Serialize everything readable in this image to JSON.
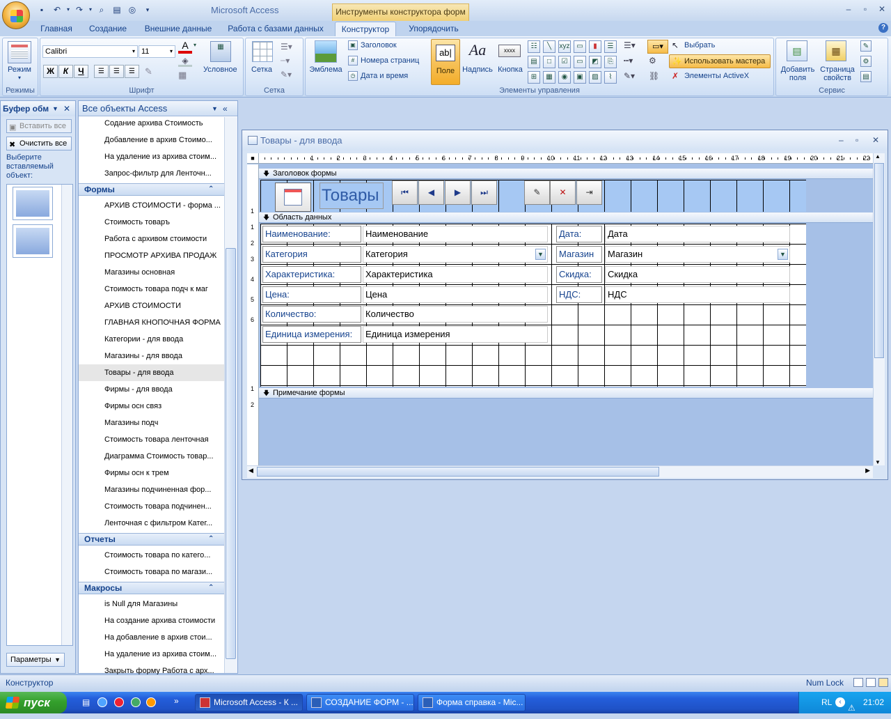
{
  "app": {
    "title": "Microsoft Access",
    "context_tool": "Инструменты конструктора форм"
  },
  "tabs": [
    "Главная",
    "Создание",
    "Внешние данные",
    "Работа с базами данных",
    "Конструктор",
    "Упорядочить"
  ],
  "active_tab": "Конструктор",
  "ribbon": {
    "mode_group": {
      "button": "Режим",
      "label": "Режимы"
    },
    "font_group": {
      "font_name": "Calibri",
      "font_size": "11",
      "conditional": "Условное",
      "label": "Шрифт",
      "bold": "Ж",
      "italic": "К",
      "underline": "Ч"
    },
    "grid_group": {
      "button": "Сетка",
      "label": "Сетка"
    },
    "controls_group": {
      "emblem": "Эмблема",
      "header_title": "Заголовок",
      "page_numbers": "Номера страниц",
      "date_time": "Дата и время",
      "field": "Поле",
      "label_ctl": "Надпись",
      "button_ctl": "Кнопка",
      "select": "Выбрать",
      "use_wizards": "Использовать мастера",
      "activex": "Элементы ActiveX",
      "label": "Элементы управления"
    },
    "tools_group": {
      "add_fields": "Добавить поля",
      "property_sheet": "Страница свойств",
      "label": "Сервис"
    }
  },
  "clipboard": {
    "title": "Буфер обм",
    "paste_all": "Вставить все",
    "clear_all": "Очистить все",
    "hint": "Выберите вставляемый объект:",
    "params": "Параметры"
  },
  "nav": {
    "header": "Все объекты Access",
    "queries": [
      "Содание архива Стоимость",
      "Добавление в архив Стоимо...",
      "На удаление из архива стоим...",
      "Запрос-фильтр для Ленточн..."
    ],
    "forms_header": "Формы",
    "forms": [
      "АРХИВ СТОИМОСТИ - форма ...",
      "Стоимость товаръ",
      "Работа с архивом стоимости",
      "ПРОСМОТР АРХИВА ПРОДАЖ",
      "Магазины основная",
      "Стоимость товара подч к маг",
      "АРХИВ СТОИМОСТИ",
      "ГЛАВНАЯ КНОПОЧНАЯ ФОРМА",
      "Категории - для ввода",
      "Магазины - для ввода",
      "Товары - для ввода",
      "Фирмы - для ввода",
      "Фирмы осн связ",
      "Магазины подч",
      "Стоимость товара ленточная",
      "Диаграмма Стоимость товар...",
      "Фирмы осн к трем",
      "Магазины подчиненная фор...",
      "Стоимость товара подчинен...",
      "Ленточная с фильтром Катег..."
    ],
    "selected_form": "Товары - для ввода",
    "reports_header": "Отчеты",
    "reports": [
      "Стоимость товара по катего...",
      "Стоимость товара по магази..."
    ],
    "macros_header": "Макросы",
    "macros": [
      "is Null для Магазины",
      "На создание архива стоимости",
      "На добавление в архив стои...",
      "На удаление из архива стоим...",
      "Закрыть форму Работа с арх..."
    ]
  },
  "form_window": {
    "title": "Товары - для ввода",
    "ruler_marks": [
      "1",
      "2",
      "3",
      "4",
      "5",
      "6",
      "7",
      "8",
      "9",
      "10",
      "11",
      "12",
      "13",
      "14",
      "15",
      "16",
      "17",
      "18",
      "19",
      "20",
      "21",
      "22",
      "23"
    ],
    "left_ruler_marks": [
      "1",
      "1",
      "2",
      "3",
      "4",
      "5",
      "6",
      "1",
      "2"
    ],
    "header_section": "Заголовок формы",
    "header_title": "Товары",
    "detail_section": "Область данных",
    "footer_section": "Примечание формы",
    "fields_left": [
      {
        "label": "Наименование:",
        "field": "Наименование"
      },
      {
        "label": "Категория",
        "field": "Категория"
      },
      {
        "label": "Характеристика:",
        "field": "Характеристика"
      },
      {
        "label": "Цена:",
        "field": "Цена"
      },
      {
        "label": "Количество:",
        "field": "Количество"
      },
      {
        "label": "Единица измерения:",
        "field": "Единица измерения"
      }
    ],
    "fields_right": [
      {
        "label": "Дата:",
        "field": "Дата"
      },
      {
        "label": "Магазин",
        "field": "Магазин"
      },
      {
        "label": "Скидка:",
        "field": "Скидка"
      },
      {
        "label": "НДС:",
        "field": "НДС"
      }
    ]
  },
  "status": {
    "mode": "Конструктор",
    "numlock": "Num Lock"
  },
  "taskbar": {
    "start": "пуск",
    "tasks": [
      "Microsoft Access - К ...",
      "СОЗДАНИЕ ФОРМ - ...",
      "Форма справка - Mic..."
    ],
    "lang": "RL",
    "time": "21:02"
  }
}
